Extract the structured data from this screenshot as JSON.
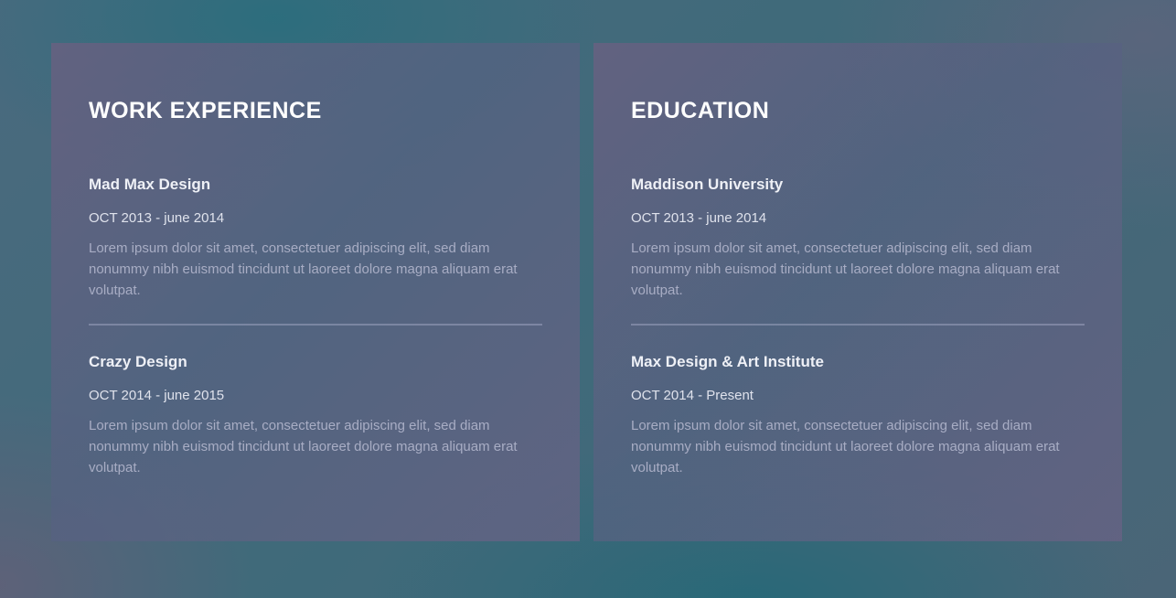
{
  "work": {
    "title": "WORK EXPERIENCE",
    "entries": [
      {
        "name": "Mad Max Design",
        "date": "OCT 2013 - june 2014",
        "description": "Lorem ipsum dolor sit amet, consectetuer adipiscing elit, sed diam nonummy nibh euismod tincidunt ut laoreet dolore magna aliquam erat volutpat."
      },
      {
        "name": "Crazy Design",
        "date": "OCT 2014 - june 2015",
        "description": "Lorem ipsum dolor sit amet, consectetuer adipiscing elit, sed diam nonummy nibh euismod tincidunt ut laoreet dolore magna aliquam erat volutpat."
      }
    ]
  },
  "education": {
    "title": "EDUCATION",
    "entries": [
      {
        "name": "Maddison University",
        "date": "OCT 2013 - june 2014",
        "description": "Lorem ipsum dolor sit amet, consectetuer adipiscing elit, sed diam nonummy nibh euismod tincidunt ut laoreet dolore magna aliquam erat volutpat."
      },
      {
        "name": "Max Design & Art Institute",
        "date": "OCT 2014 - Present",
        "description": "Lorem ipsum dolor sit amet, consectetuer adipiscing elit, sed diam nonummy nibh euismod tincidunt ut laoreet dolore magna aliquam erat volutpat."
      }
    ]
  }
}
